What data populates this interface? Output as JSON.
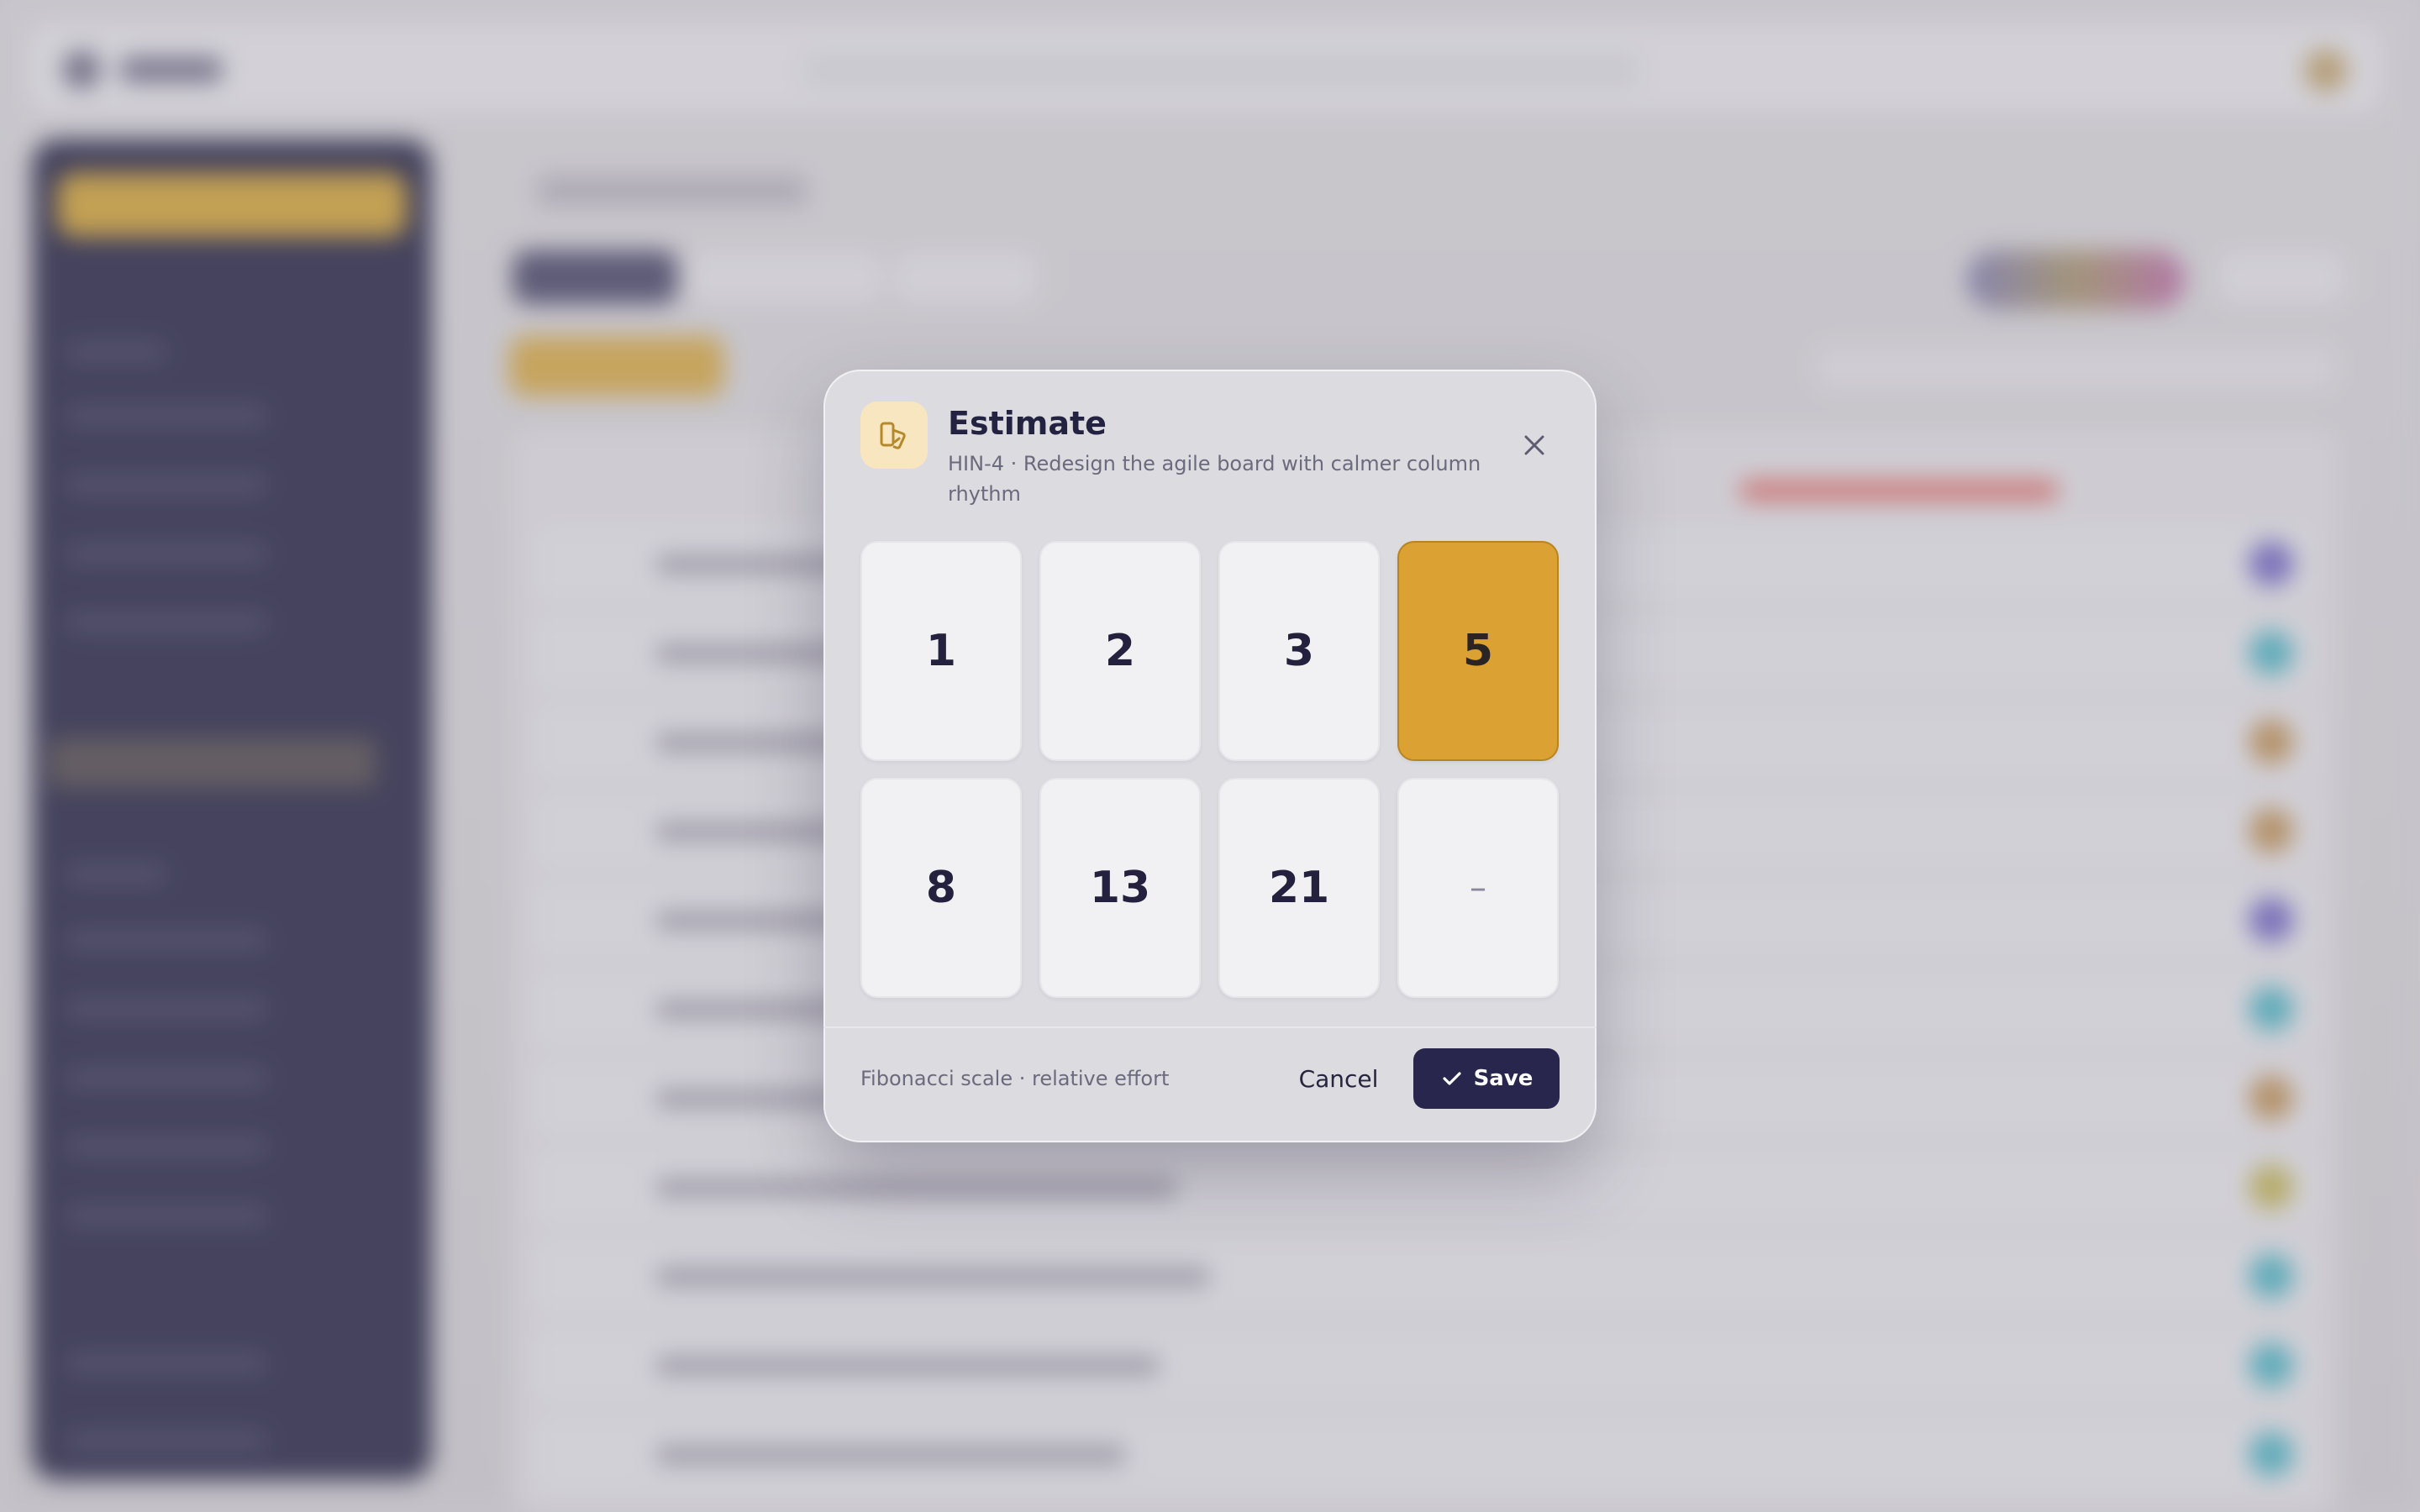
{
  "dialog": {
    "title": "Estimate",
    "subtitle": "HIN-4 · Redesign the agile board with calmer column rhythm",
    "icon": "estimate-cards-icon",
    "close_icon": "close-icon",
    "accent_color": "#dba233",
    "options": [
      {
        "label": "1",
        "selected": false
      },
      {
        "label": "2",
        "selected": false
      },
      {
        "label": "3",
        "selected": false
      },
      {
        "label": "5",
        "selected": true
      },
      {
        "label": "8",
        "selected": false
      },
      {
        "label": "13",
        "selected": false
      },
      {
        "label": "21",
        "selected": false
      },
      {
        "label": "–",
        "selected": false
      }
    ],
    "footer_note": "Fibonacci scale · relative effort",
    "cancel_label": "Cancel",
    "save_label": "Save",
    "save_icon": "check-icon",
    "save_color": "#29264d"
  }
}
